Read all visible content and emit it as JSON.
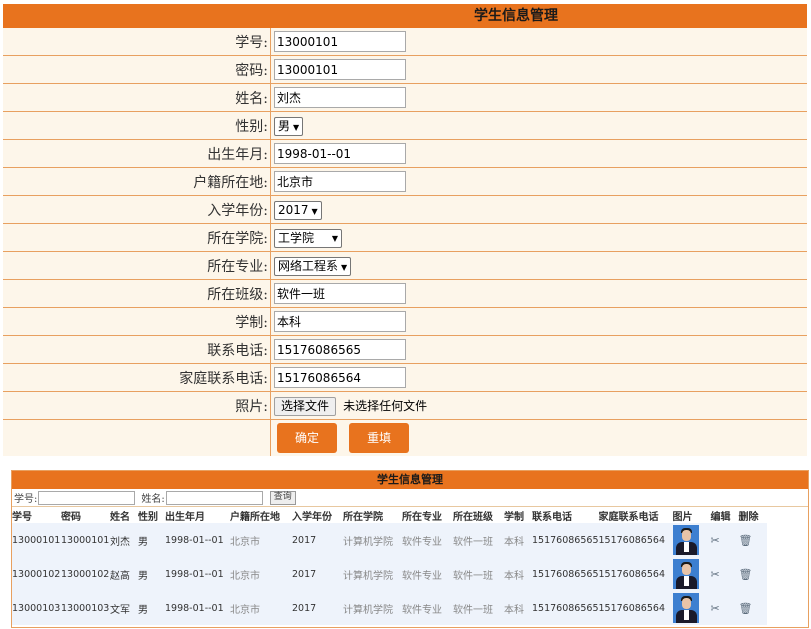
{
  "form": {
    "title": "学生信息管理",
    "fields": {
      "student_id": {
        "label": "学号:",
        "value": "13000101"
      },
      "password": {
        "label": "密码:",
        "value": "13000101"
      },
      "name": {
        "label": "姓名:",
        "value": "刘杰"
      },
      "gender": {
        "label": "性别:",
        "value": "男"
      },
      "birth": {
        "label": "出生年月:",
        "value": "1998-01--01"
      },
      "hometown": {
        "label": "户籍所在地:",
        "value": "北京市"
      },
      "enroll_year": {
        "label": "入学年份:",
        "value": "2017"
      },
      "college": {
        "label": "所在学院:",
        "value": "工学院"
      },
      "major": {
        "label": "所在专业:",
        "value": "网络工程系"
      },
      "class": {
        "label": "所在班级:",
        "value": "软件一班"
      },
      "system": {
        "label": "学制:",
        "value": "本科"
      },
      "phone": {
        "label": "联系电话:",
        "value": "15176086565"
      },
      "family_phone": {
        "label": "家庭联系电话:",
        "value": "15176086564"
      },
      "photo": {
        "label": "照片:",
        "button": "选择文件",
        "status": "未选择任何文件"
      }
    },
    "confirm_label": "确定",
    "reset_label": "重填"
  },
  "grid": {
    "title": "学生信息管理",
    "search": {
      "id_label": "学号:",
      "name_label": "姓名:",
      "button": "查询"
    },
    "columns": [
      "学号",
      "密码",
      "姓名",
      "性别",
      "出生年月",
      "户籍所在地",
      "入学年份",
      "所在学院",
      "所在专业",
      "所在班级",
      "学制",
      "联系电话",
      "家庭联系电话",
      "图片",
      "编辑",
      "删除"
    ],
    "rows": [
      {
        "id": "13000101",
        "pwd": "13000101",
        "name": "刘杰",
        "gender": "男",
        "birth": "1998-01--01",
        "home": "北京市",
        "year": "2017",
        "college": "计算机学院",
        "major": "软件专业",
        "class": "软件一班",
        "system": "本科",
        "phone": "15176086565",
        "fphone": "15176086564"
      },
      {
        "id": "13000102",
        "pwd": "13000102",
        "name": "赵高",
        "gender": "男",
        "birth": "1998-01--01",
        "home": "北京市",
        "year": "2017",
        "college": "计算机学院",
        "major": "软件专业",
        "class": "软件一班",
        "system": "本科",
        "phone": "15176086565",
        "fphone": "15176086564"
      },
      {
        "id": "13000103",
        "pwd": "13000103",
        "name": "文军",
        "gender": "男",
        "birth": "1998-01--01",
        "home": "北京市",
        "year": "2017",
        "college": "计算机学院",
        "major": "软件专业",
        "class": "软件一班",
        "system": "本科",
        "phone": "15176086565",
        "fphone": "15176086564"
      }
    ]
  },
  "icons": {
    "edit": "tools-icon",
    "delete": "trash-icon"
  },
  "colors": {
    "accent": "#e8731e",
    "form_bg": "#fdf6ea",
    "row_bg": "#eef3fb"
  }
}
